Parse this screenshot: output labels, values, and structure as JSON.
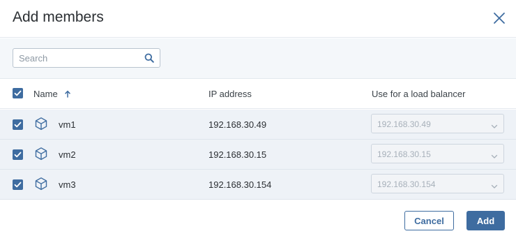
{
  "dialog": {
    "title": "Add members"
  },
  "search": {
    "placeholder": "Search",
    "value": ""
  },
  "table": {
    "columns": {
      "name": "Name",
      "ip": "IP address",
      "lb": "Use for a load balancer"
    },
    "sort": {
      "column": "Name",
      "direction": "ascending"
    },
    "rows": [
      {
        "name": "vm1",
        "ip": "192.168.30.49",
        "lb": "192.168.30.49",
        "checked": true
      },
      {
        "name": "vm2",
        "ip": "192.168.30.15",
        "lb": "192.168.30.15",
        "checked": true
      },
      {
        "name": "vm3",
        "ip": "192.168.30.154",
        "lb": "192.168.30.154",
        "checked": true
      }
    ]
  },
  "buttons": {
    "cancel": "Cancel",
    "add": "Add"
  },
  "colors": {
    "accent": "#3e6ca0",
    "row_bg": "#eef2f7",
    "toolbar_bg": "#f4f7fa"
  }
}
